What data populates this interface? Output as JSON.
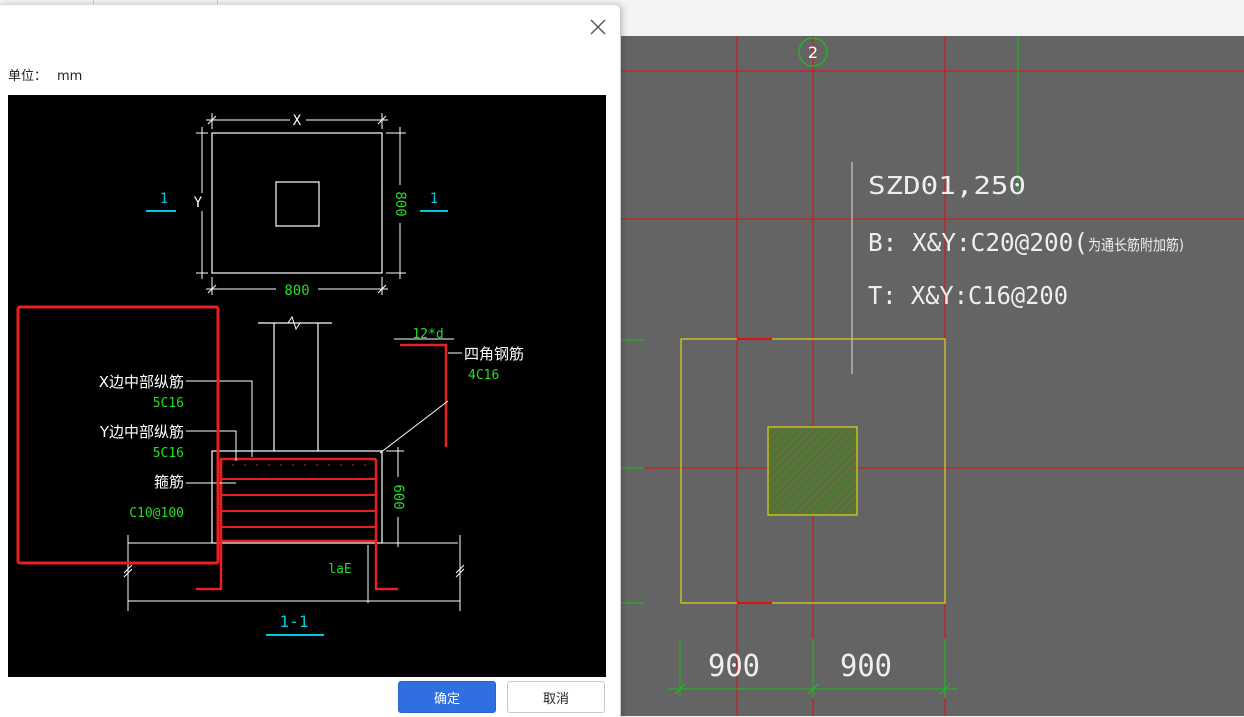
{
  "dialog": {
    "unit_label": "单位：",
    "unit_value": "mm",
    "ok_label": "确定",
    "cancel_label": "取消"
  },
  "diagram": {
    "plan": {
      "x_label": "X",
      "y_label": "Y",
      "width_dim": "800",
      "height_dim": "800",
      "section_mark": "1"
    },
    "section": {
      "corner_bar_label": "四角钢筋",
      "corner_bar_value": "4C16",
      "anchor_label": "12*d",
      "x_mid_bar_label": "X边中部纵筋",
      "x_mid_bar_value": "5C16",
      "y_mid_bar_label": "Y边中部纵筋",
      "y_mid_bar_value": "5C16",
      "stirrup_label": "箍筋",
      "stirrup_value": "C10@100",
      "depth_dim": "600",
      "lae_label": "laE",
      "section_title": "1-1"
    }
  },
  "cad": {
    "axis_bubble": "2",
    "annotation_line1": "SZD01,250",
    "annotation_line2": "B: X&Y:C20@200(",
    "annotation_note": "为通长筋附加筋)",
    "annotation_line3": "T: X&Y:C16@200",
    "dim_left": "900",
    "dim_right": "900"
  },
  "colors": {
    "cad_bg": "#646464",
    "axis_red": "#e01010",
    "axis_green": "#19c019",
    "outline_yellow": "#e0d020",
    "dim_cyan": "#00c8e0",
    "text_green": "#22dd22",
    "rebar_red": "#e82020",
    "primary_button": "#2f6fe0"
  }
}
